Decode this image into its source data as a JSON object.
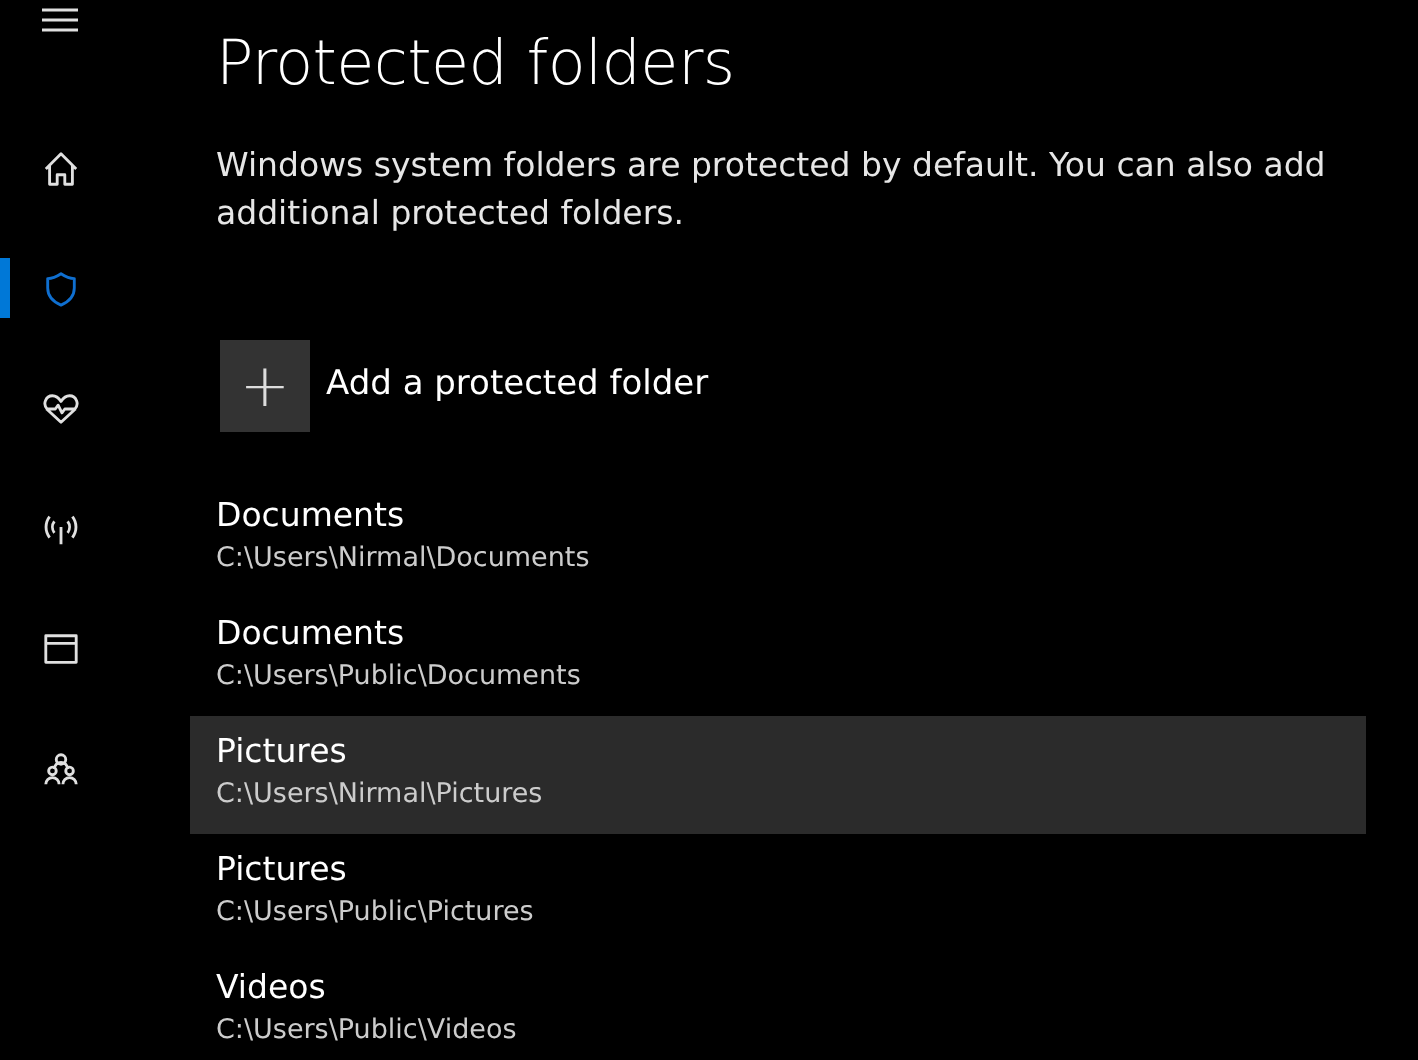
{
  "sidebar": {
    "items": [
      {
        "kind": "menu",
        "selected": false
      },
      {
        "kind": "home",
        "selected": false
      },
      {
        "kind": "shield",
        "selected": true
      },
      {
        "kind": "heart",
        "selected": false
      },
      {
        "kind": "antenna",
        "selected": false
      },
      {
        "kind": "window",
        "selected": false
      },
      {
        "kind": "family",
        "selected": false
      }
    ]
  },
  "page": {
    "title": "Protected folders",
    "description": "Windows system folders are protected by default. You can also add additional protected folders."
  },
  "add_button": {
    "icon": "+",
    "label": "Add a protected folder"
  },
  "folders": [
    {
      "name": "Documents",
      "path": "C:\\Users\\Nirmal\\Documents",
      "selected": false
    },
    {
      "name": "Documents",
      "path": "C:\\Users\\Public\\Documents",
      "selected": false
    },
    {
      "name": "Pictures",
      "path": "C:\\Users\\Nirmal\\Pictures",
      "selected": true
    },
    {
      "name": "Pictures",
      "path": "C:\\Users\\Public\\Pictures",
      "selected": false
    },
    {
      "name": "Videos",
      "path": "C:\\Users\\Public\\Videos",
      "selected": false
    }
  ]
}
